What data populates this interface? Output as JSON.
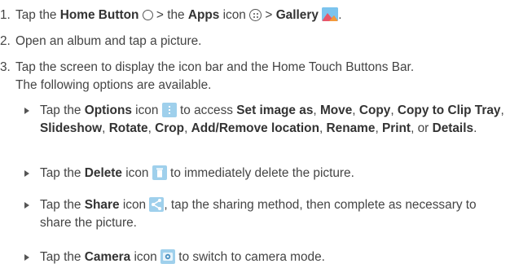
{
  "steps": [
    {
      "num": "1.",
      "p1": "Tap the ",
      "b1": "Home Button",
      "p2": " > the ",
      "b2": "Apps",
      "p3": " icon ",
      "p4": " > ",
      "b3": "Gallery",
      "p5": "."
    },
    {
      "num": "2.",
      "text": "Open an album and tap a picture."
    },
    {
      "num": "3.",
      "line1": "Tap the screen to display the icon bar and the Home Touch Buttons Bar.",
      "line2": "The following options are available."
    }
  ],
  "bullets": {
    "options": {
      "p1": "Tap the ",
      "b1": "Options",
      "p2": " icon ",
      "p3": " to access ",
      "b2": "Set image as",
      "p4": ", ",
      "b3": "Move",
      "p5": ", ",
      "b4": "Copy",
      "p6": ", ",
      "b5": "Copy to Clip Tray",
      "p7": ", ",
      "b6": "Slideshow",
      "p8": ", ",
      "b7": "Rotate",
      "p9": ", ",
      "b8": "Crop",
      "p10": ", ",
      "b9": "Add/Remove location",
      "p11": ", ",
      "b10": "Rename",
      "p12": ", ",
      "b11": "Print",
      "p13": ", or ",
      "b12": "Details",
      "p14": "."
    },
    "delete": {
      "p1": "Tap the ",
      "b1": "Delete",
      "p2": " icon ",
      "p3": " to immediately delete the picture."
    },
    "share": {
      "p1": "Tap the ",
      "b1": "Share",
      "p2": " icon ",
      "p3": ", tap the sharing method, then complete as necessary to share the picture."
    },
    "camera": {
      "p1": "Tap the ",
      "b1": "Camera",
      "p2": " icon ",
      "p3": " to switch to camera mode."
    }
  },
  "icons": [
    "circle-home-icon",
    "apps-grid-icon",
    "gallery-icon",
    "options-menu-icon",
    "trash-icon",
    "share-icon",
    "camera-icon"
  ],
  "colors": {
    "text": "#444444",
    "icon_bg": "#9fd0ec",
    "gallery_sky": "#7cc4ee"
  }
}
